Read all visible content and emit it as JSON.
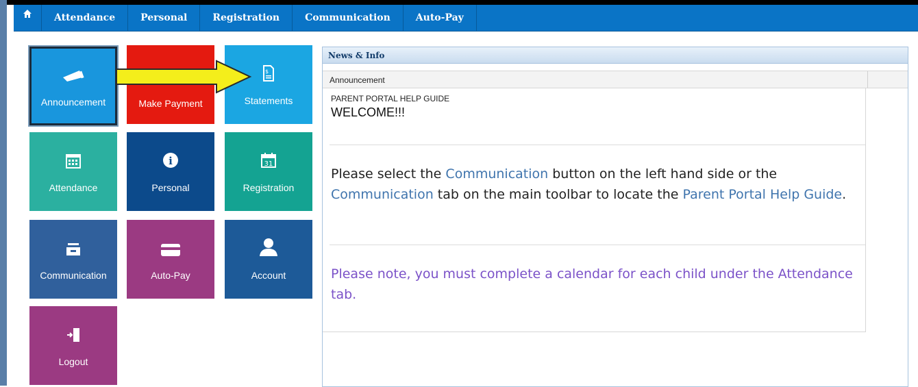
{
  "nav": {
    "home_icon": "home-icon",
    "items": [
      "Attendance",
      "Personal",
      "Registration",
      "Communication",
      "Auto-Pay"
    ]
  },
  "tiles": [
    {
      "label": "Announcement",
      "icon": "megaphone-icon",
      "color": "#1996dd",
      "selected": true
    },
    {
      "label": "Make Payment",
      "icon": "none",
      "color": "#e41a10"
    },
    {
      "label": "Statements",
      "icon": "document-dollar-icon",
      "color": "#1ba6e2"
    },
    {
      "label": "Attendance",
      "icon": "calendar-grid-icon",
      "color": "#2bb0a0"
    },
    {
      "label": "Personal",
      "icon": "info-icon",
      "color": "#0c4a8b"
    },
    {
      "label": "Registration",
      "icon": "calendar-31-icon",
      "color": "#14a392"
    },
    {
      "label": "Communication",
      "icon": "inbox-icon",
      "color": "#30609c"
    },
    {
      "label": "Auto-Pay",
      "icon": "credit-card-icon",
      "color": "#9b3a82"
    },
    {
      "label": "Account",
      "icon": "user-icon",
      "color": "#1d5a98"
    },
    {
      "label": "Logout",
      "icon": "logout-door-icon",
      "color": "#9b3a82"
    }
  ],
  "annotation": {
    "arrow_color": "#f4ee1b",
    "arrow_outline": "#2a2a2a"
  },
  "panel": {
    "title": "News & Info",
    "column_header": "Announcement",
    "help_guide_title": "PARENT PORTAL HELP GUIDE",
    "welcome": "WELCOME!!!",
    "para1": {
      "t1": "Please select the ",
      "link1": "Communication",
      "t2": " button on the left hand side or the ",
      "link2": "Communication",
      "t3": " tab on the main toolbar to locate the ",
      "link3": "Parent Portal Help Guide",
      "t4": "."
    },
    "note": "Please note, you must complete a calendar for each child under the Attendance tab."
  },
  "colors": {
    "nav_bg": "#0a74c6",
    "link": "#3f74ad",
    "note": "#7b52c8"
  }
}
